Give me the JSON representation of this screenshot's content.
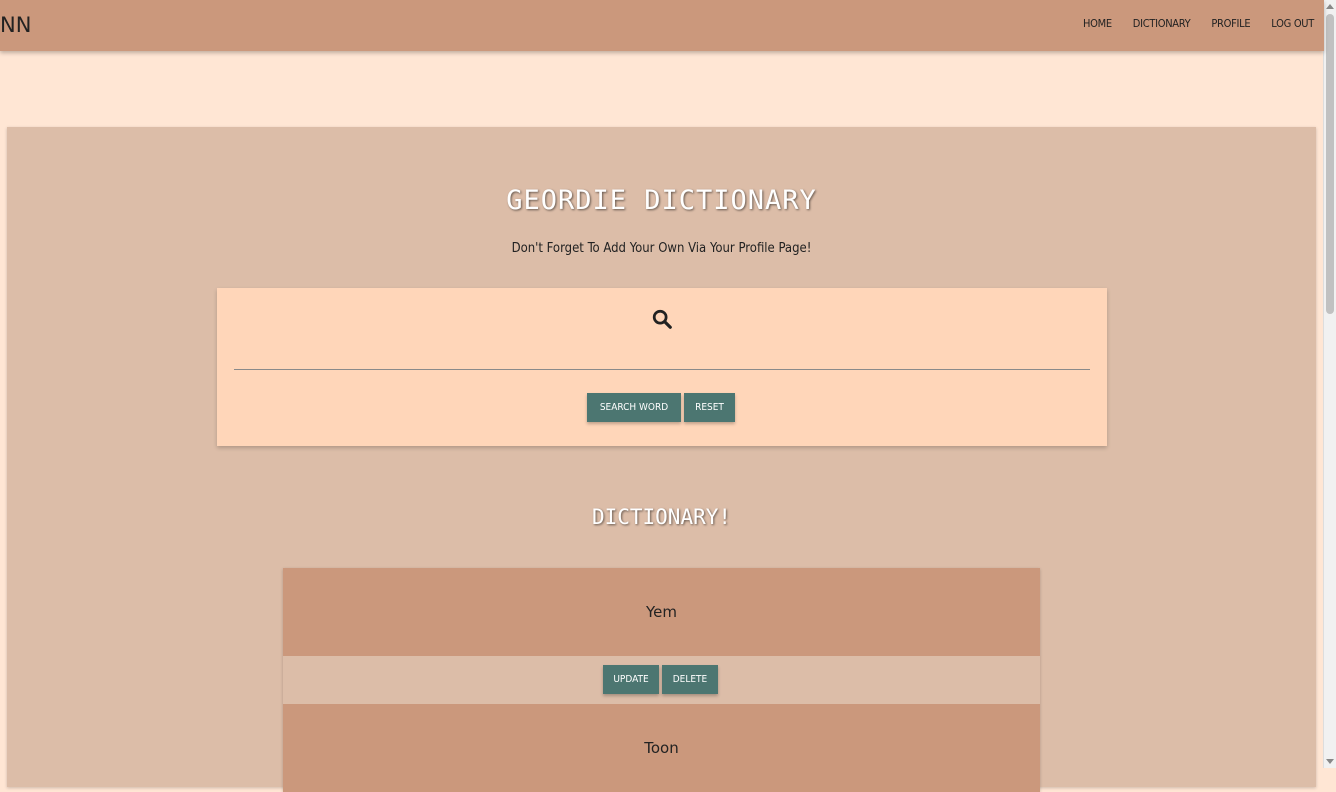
{
  "navbar": {
    "brand": "NN",
    "links": [
      "HOME",
      "DICTIONARY",
      "PROFILE",
      "LOG OUT"
    ]
  },
  "main": {
    "title": "GEORDIE DICTIONARY",
    "subtitle": "Don't Forget To Add Your Own Via Your Profile Page!",
    "search": {
      "icon": "search-icon",
      "input_value": "",
      "search_label": "SEARCH WORD",
      "reset_label": "RESET"
    },
    "section_title": "DICTIONARY!",
    "entries": [
      {
        "word": "Yem",
        "update_label": "UPDATE",
        "delete_label": "DELETE"
      },
      {
        "word": "Toon"
      }
    ]
  },
  "colors": {
    "navbar": "#cb987c",
    "page_bg": "#ffe6d4",
    "card_bg": "#dcbda8",
    "search_card_bg": "#ffd6b9",
    "button": "#4c7671"
  }
}
